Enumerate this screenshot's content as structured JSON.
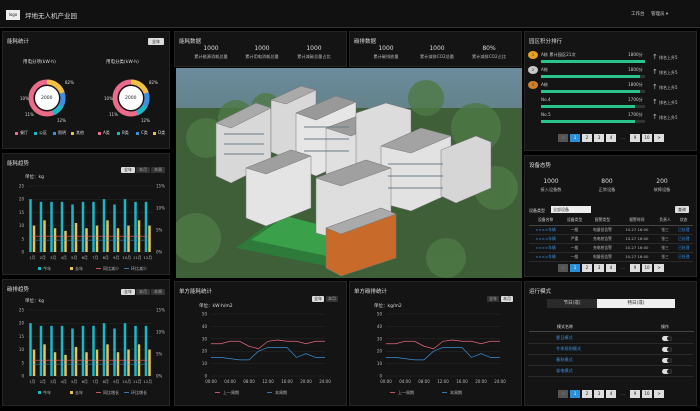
{
  "header": {
    "logo": "logo",
    "title": "坪地无人机产业园",
    "user1": "工作台",
    "user2": "管理员 ▾"
  },
  "energy": {
    "title": "能耗统计",
    "btn": "全年",
    "donut1": {
      "title": "用电分项(kW·h)",
      "center": "2000",
      "labels": [
        "82%",
        "10%",
        "11%",
        "12%"
      ],
      "legend": [
        "餐厅",
        "公区",
        "照明",
        "其他"
      ]
    },
    "donut2": {
      "title": "用电分类(kW·h)",
      "center": "2000",
      "labels": [
        "82%",
        "10%",
        "11%",
        "12%"
      ],
      "legend": [
        "A类",
        "B类",
        "C类",
        "D类"
      ]
    }
  },
  "elecTrend": {
    "title": "能耗趋势",
    "unit": "单位：kg",
    "tabs": [
      "全年",
      "本月",
      "本周"
    ],
    "y_left": [
      "0",
      "5",
      "10",
      "15",
      "20",
      "25"
    ],
    "y_right": [
      "0%",
      "5%",
      "10%",
      "15%"
    ],
    "legend": [
      "今年",
      "去年",
      "同比减少",
      "环比减少"
    ]
  },
  "carbonTrend": {
    "title": "碳排趋势",
    "unit": "单位：kg",
    "tabs": [
      "全年",
      "本月",
      "本周"
    ],
    "y_left": [
      "0",
      "5",
      "10",
      "15",
      "20",
      "25"
    ],
    "y_right": [
      "0%",
      "5%",
      "10%",
      "15%"
    ],
    "legend": [
      "今年",
      "去年",
      "同比增长",
      "环比增长"
    ]
  },
  "energyData": {
    "title": "能耗数据",
    "stats": [
      {
        "v": "1000",
        "l": "累计能源消耗总量"
      },
      {
        "v": "1000",
        "l": "累计用电消耗总量"
      },
      {
        "v": "1000",
        "l": "累计减碳总量占比"
      }
    ]
  },
  "carbonData": {
    "title": "碳排数据",
    "stats": [
      {
        "v": "1000",
        "l": "累计碳排放量"
      },
      {
        "v": "1000",
        "l": "累计减排CO2总量"
      },
      {
        "v": "80%",
        "l": "累计减排CO2占比"
      }
    ]
  },
  "ranking": {
    "title": "园区积分排行",
    "items": [
      {
        "badge": "1",
        "name": "A栋 累计园区21次",
        "score": "1800分",
        "change": "排名上升5"
      },
      {
        "badge": "2",
        "name": "A栋",
        "score": "1800分",
        "change": "排名上升5"
      },
      {
        "badge": "3",
        "name": "A栋",
        "score": "1800分",
        "change": "排名上升5"
      },
      {
        "badge": "",
        "name": "No.4",
        "score": "1700分",
        "change": "排名上升5"
      },
      {
        "badge": "",
        "name": "No.5",
        "score": "1700分",
        "change": "排名上升5"
      }
    ],
    "fill": [
      1.0,
      0.95,
      0.95,
      0.9,
      0.9
    ],
    "pages": [
      "<",
      "1",
      "2",
      "3",
      "4",
      "...",
      "9",
      "10",
      ">"
    ]
  },
  "devices": {
    "title": "设备态势",
    "stats": [
      {
        "v": "1000",
        "l": "接入设备数"
      },
      {
        "v": "800",
        "l": "正常设备"
      },
      {
        "v": "200",
        "l": "故障设备"
      }
    ],
    "filterLabel": "设备类型",
    "filterValue": "全部设备",
    "queryBtn": "查询",
    "columns": [
      "设备名称",
      "设备类型",
      "报警类型",
      "报警时间",
      "负责人",
      "状态"
    ],
    "rows": [
      [
        "××××车辆",
        "一般",
        "电量低告警",
        "10-27 16:00",
        "张三",
        "已处理"
      ],
      [
        "××××车辆",
        "严重",
        "充电桩告警",
        "10-27 16:00",
        "张三",
        "已处理"
      ],
      [
        "××××车辆",
        "一般",
        "充电桩告警",
        "10-27 16:00",
        "张三",
        "已处理"
      ],
      [
        "××××车辆",
        "一般",
        "电量低告警",
        "10-27 16:00",
        "张三",
        "已处理"
      ]
    ],
    "pages": [
      "<",
      "1",
      "2",
      "3",
      "4",
      "...",
      "9",
      "10",
      ">"
    ]
  },
  "unitEnergy": {
    "title": "单方能耗统计",
    "unit": "单位：kW·h/m2",
    "tabs": [
      "全年",
      "本月"
    ],
    "y": [
      "0",
      "10",
      "20",
      "30",
      "40",
      "50"
    ],
    "x": [
      "00:00",
      "04:00",
      "08:00",
      "12:00",
      "16:00",
      "20:00",
      "24:00"
    ],
    "legend": [
      "上一周期",
      "本周期"
    ]
  },
  "unitCarbon": {
    "title": "单方碳排统计",
    "unit": "单位：kg/m2",
    "tabs": [
      "全年",
      "本月"
    ],
    "y": [
      "0",
      "10",
      "20",
      "30",
      "40",
      "50"
    ],
    "x": [
      "00:00",
      "04:00",
      "08:00",
      "12:00",
      "16:00",
      "20:00",
      "24:00"
    ],
    "legend": [
      "上一周期",
      "本周期"
    ]
  },
  "mode": {
    "title": "运行模式",
    "tabs": [
      "节日(或)",
      "特日(或)"
    ],
    "columns": [
      "模式名称",
      "操作"
    ],
    "rows": [
      "夏日模式",
      "冬季规则模式",
      "春秋模式",
      "省电模式"
    ],
    "pages": [
      "<",
      "1",
      "2",
      "3",
      "4",
      "...",
      "9",
      "10",
      ">"
    ]
  },
  "colors": {
    "bar_cur": "#18b8c6",
    "bar_prev": "#e8c35a",
    "line1": "#e86a7a",
    "line2": "#3b8fd8",
    "bg": "#141414"
  },
  "chart_data": [
    {
      "type": "bar",
      "name": "能耗趋势",
      "categories": [
        "1月",
        "2月",
        "3月",
        "4月",
        "5月",
        "6月",
        "7月",
        "8月",
        "9月",
        "10月",
        "11月",
        "12月"
      ],
      "series": [
        {
          "name": "今年",
          "values": [
            20,
            19,
            19,
            19,
            18,
            19,
            19,
            20,
            18,
            20,
            19,
            19
          ]
        },
        {
          "name": "去年",
          "values": [
            10,
            12,
            9,
            8,
            11,
            9,
            10,
            12,
            9,
            10,
            12,
            10
          ]
        },
        {
          "name": "同比减少",
          "values": [
            4,
            4,
            4,
            4,
            4,
            4,
            4,
            4,
            4,
            4,
            4,
            4
          ]
        },
        {
          "name": "环比减少",
          "values": [
            3,
            3,
            3,
            3,
            3,
            3,
            3,
            3,
            3,
            3,
            3,
            3
          ]
        }
      ],
      "ylim": [
        0,
        25
      ]
    },
    {
      "type": "bar",
      "name": "碳排趋势",
      "categories": [
        "1月",
        "2月",
        "3月",
        "4月",
        "5月",
        "6月",
        "7月",
        "8月",
        "9月",
        "10月",
        "11月",
        "12月"
      ],
      "series": [
        {
          "name": "今年",
          "values": [
            20,
            19,
            19,
            19,
            18,
            19,
            19,
            20,
            18,
            20,
            19,
            19
          ]
        },
        {
          "name": "去年",
          "values": [
            10,
            12,
            9,
            8,
            11,
            9,
            10,
            12,
            9,
            10,
            12,
            10
          ]
        },
        {
          "name": "同比增长",
          "values": [
            4,
            4,
            4,
            4,
            4,
            4,
            4,
            4,
            4,
            4,
            4,
            4
          ]
        },
        {
          "name": "环比增长",
          "values": [
            3,
            3,
            3,
            3,
            3,
            3,
            3,
            3,
            3,
            3,
            3,
            3
          ]
        }
      ],
      "ylim": [
        0,
        25
      ]
    },
    {
      "type": "line",
      "name": "单方能耗统计",
      "x": [
        "00:00",
        "02:00",
        "04:00",
        "06:00",
        "08:00",
        "10:00",
        "12:00",
        "14:00",
        "16:00",
        "18:00",
        "20:00",
        "22:00",
        "24:00"
      ],
      "series": [
        {
          "name": "上一周期",
          "values": [
            26,
            26,
            28,
            28,
            24,
            22,
            28,
            29,
            28,
            28,
            26,
            28,
            28
          ]
        },
        {
          "name": "本周期",
          "values": [
            15,
            15,
            14,
            13,
            13,
            20,
            23,
            23,
            23,
            15,
            18,
            15,
            15
          ]
        }
      ],
      "ylim": [
        0,
        50
      ]
    },
    {
      "type": "line",
      "name": "单方碳排统计",
      "x": [
        "00:00",
        "02:00",
        "04:00",
        "06:00",
        "08:00",
        "10:00",
        "12:00",
        "14:00",
        "16:00",
        "18:00",
        "20:00",
        "22:00",
        "24:00"
      ],
      "series": [
        {
          "name": "上一周期",
          "values": [
            26,
            26,
            28,
            28,
            24,
            22,
            28,
            29,
            28,
            28,
            26,
            28,
            28
          ]
        },
        {
          "name": "本周期",
          "values": [
            15,
            15,
            14,
            13,
            13,
            20,
            23,
            23,
            23,
            15,
            18,
            15,
            15
          ]
        }
      ],
      "ylim": [
        0,
        50
      ]
    }
  ]
}
